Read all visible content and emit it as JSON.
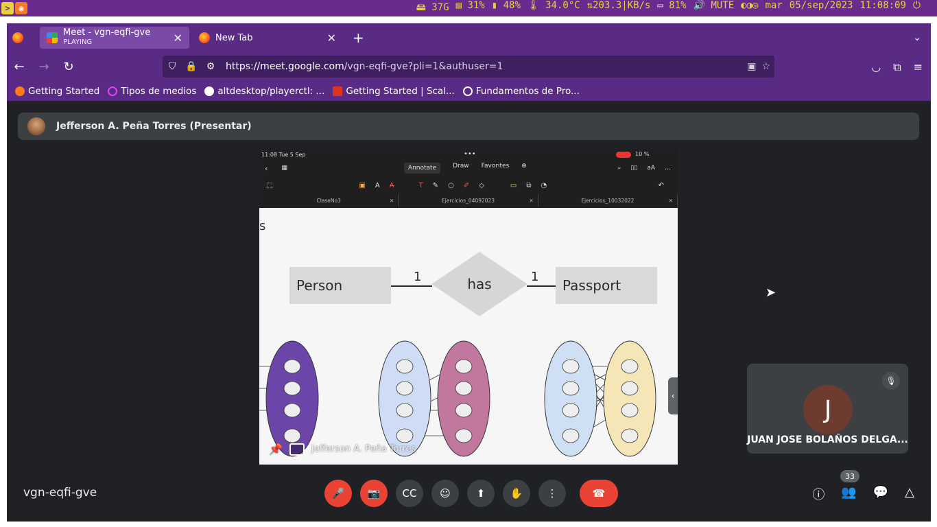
{
  "statusbar": {
    "items": [
      "37G",
      "31%",
      "48%",
      "34.0°C",
      "203.3|KB/s",
      "81%",
      "MUTE",
      "mar",
      "05/sep/2023",
      "11:08:09"
    ]
  },
  "browser": {
    "tabs": [
      {
        "title": "Meet - vgn-eqfi-gve",
        "subtitle": "PLAYING"
      },
      {
        "title": "New Tab"
      }
    ],
    "url": {
      "host": "https://meet.google.com",
      "path": "/vgn-eqfi-gve?pli=1&authuser=1"
    },
    "bookmarks": [
      "Getting Started",
      "Tipos de medios",
      "altdesktop/playerctl: ...",
      "Getting Started | Scal...",
      "Fundamentos de Pro..."
    ]
  },
  "meet": {
    "presenter": "Jefferson A. Peña Torres (Presentar)",
    "share_footer": "Jefferson A. Peña Torres",
    "meeting_code": "vgn-eqfi-gve",
    "participant_count": "33",
    "tile": {
      "initial": "J",
      "name": "JUAN JOSE BOLAÑOS DELGA..."
    }
  },
  "ipad": {
    "time": "11:08  Tue 5 Sep",
    "modes": [
      "Annotate",
      "Draw",
      "Favorites"
    ],
    "status": "10 %",
    "doc_tabs": [
      "ClaseNo3",
      "Ejercicios_04092023",
      "Ejercicios_10032022"
    ],
    "er": {
      "entity_left": "Person",
      "relationship": "has",
      "entity_right": "Passport",
      "card_left": "1",
      "card_right": "1",
      "stray": "s"
    }
  },
  "colors": {
    "bar": "#6b2a8e",
    "browser": "#5a2b84",
    "meet_bg": "#202124",
    "red": "#ea4335"
  }
}
